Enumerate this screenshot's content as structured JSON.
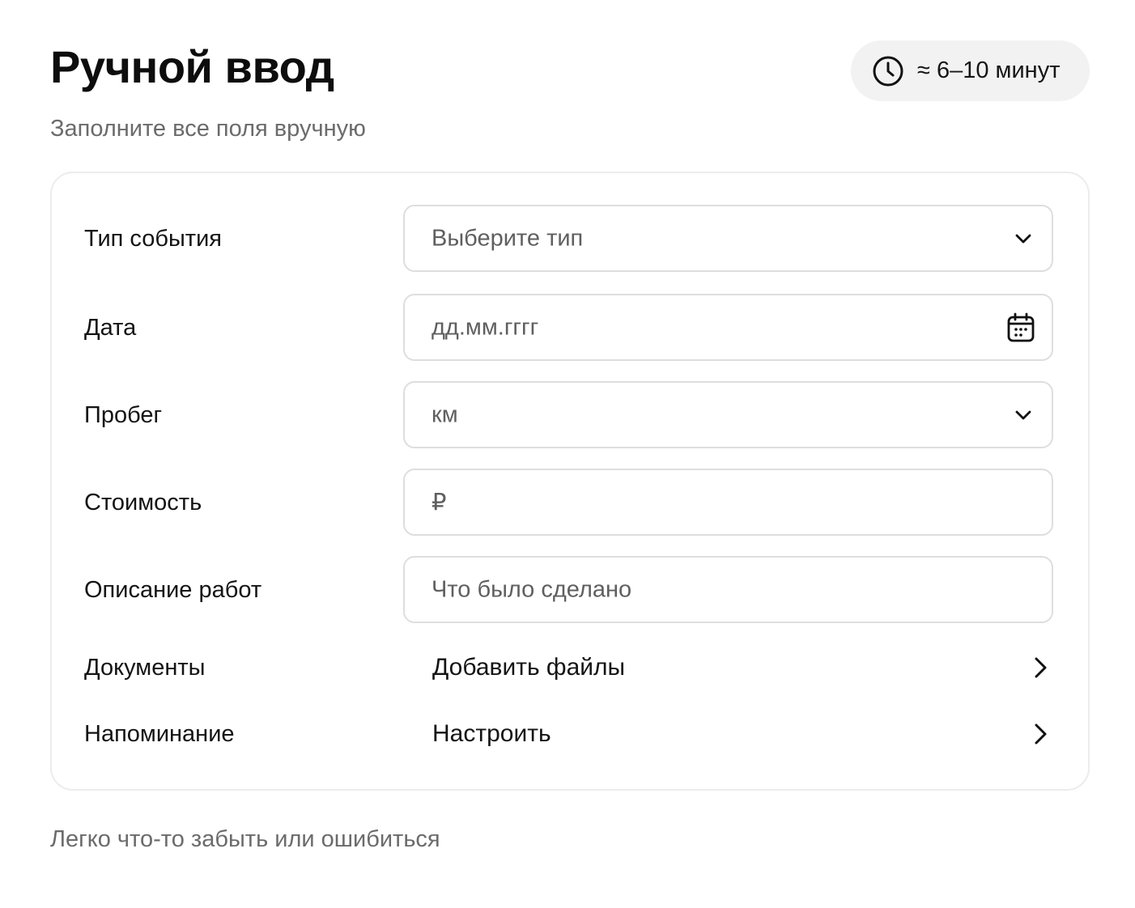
{
  "header": {
    "title": "Ручной ввод",
    "subtitle": "Заполните все поля вручную",
    "badge": {
      "icon": "clock-icon",
      "text": "≈ 6–10 минут"
    }
  },
  "form": {
    "event_type": {
      "label": "Тип события",
      "placeholder": "Выберите тип",
      "icon": "chevron-down-icon"
    },
    "date": {
      "label": "Дата",
      "placeholder": "дд.мм.гггг",
      "icon": "calendar-icon"
    },
    "mileage": {
      "label": "Пробег",
      "placeholder": "км",
      "icon": "chevron-down-icon"
    },
    "cost": {
      "label": "Стоимость",
      "placeholder": "₽"
    },
    "description": {
      "label": "Описание работ",
      "placeholder": "Что было сделано"
    },
    "documents": {
      "label": "Документы",
      "action": "Добавить файлы",
      "icon": "chevron-right-icon"
    },
    "reminder": {
      "label": "Напоминание",
      "action": "Настроить",
      "icon": "chevron-right-icon"
    }
  },
  "footer": {
    "note": "Легко что-то забыть или ошибиться"
  },
  "colors": {
    "text_primary": "#111111",
    "text_secondary": "#6b6b6b",
    "badge_bg": "#f2f2f2",
    "field_border": "#dedede",
    "card_border": "#ececec"
  }
}
